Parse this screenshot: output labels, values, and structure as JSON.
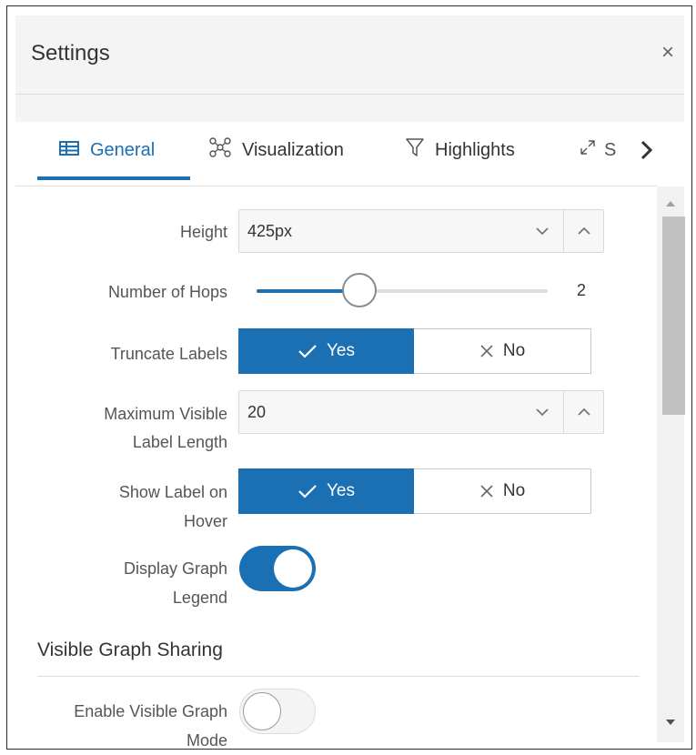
{
  "dialog": {
    "title": "Settings",
    "close_glyph": "×"
  },
  "tabs": [
    {
      "label": "General",
      "icon": "table-icon",
      "active": true
    },
    {
      "label": "Visualization",
      "icon": "network-icon",
      "active": false
    },
    {
      "label": "Highlights",
      "icon": "filter-icon",
      "active": false
    },
    {
      "label": "S",
      "icon": "expand-icon",
      "active": false
    }
  ],
  "fields": {
    "height": {
      "label": "Height",
      "value": "425px"
    },
    "hops": {
      "label": "Number of Hops",
      "value": "2",
      "level": 0.3
    },
    "truncate": {
      "label": "Truncate Labels",
      "yes": "Yes",
      "no": "No",
      "selected": "Yes"
    },
    "max_label": {
      "label_line1": "Maximum Visible",
      "label_line2": "Label Length",
      "value": "20"
    },
    "hover": {
      "label_line1": "Show Label on",
      "label_line2": "Hover",
      "yes": "Yes",
      "no": "No",
      "selected": "Yes"
    },
    "legend": {
      "label_line1": "Display Graph",
      "label_line2": "Legend",
      "on": true
    }
  },
  "section": {
    "title": "Visible Graph Sharing",
    "enable": {
      "label_line1": "Enable Visible Graph",
      "label_line2": "Mode",
      "on": false
    }
  },
  "colors": {
    "accent": "#1b6fb3",
    "border": "#d9d9d9",
    "muted": "#f4f4f4"
  }
}
